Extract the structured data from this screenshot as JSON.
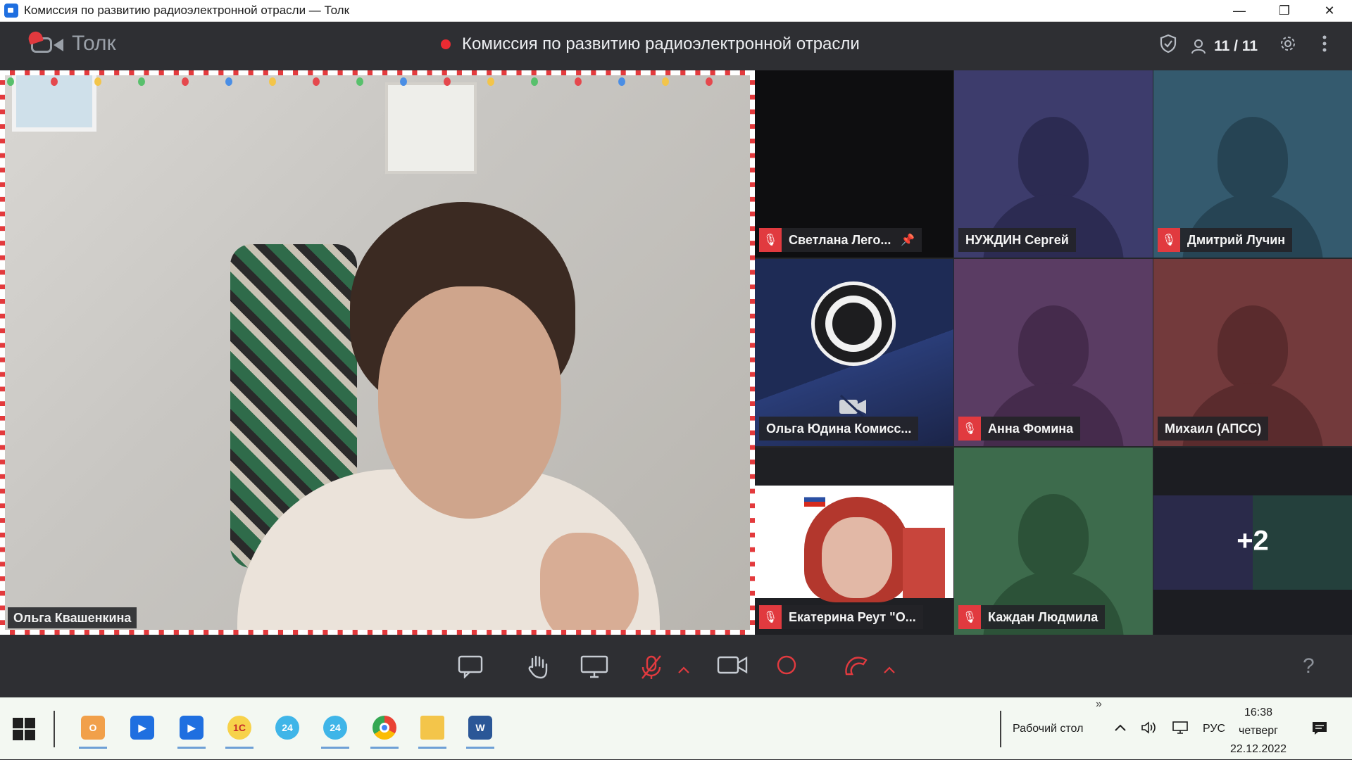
{
  "window": {
    "title": "Комиссия по развитию радиоэлектронной отрасли — Толк",
    "controls": [
      "—",
      "❐",
      "✕"
    ]
  },
  "app": {
    "name": "Толк",
    "meeting_title": "Комиссия по развитию радиоэлектронной отрасли",
    "participants_count": "11 / 11",
    "accent_color": "#e13a3f"
  },
  "main_speaker": {
    "name": "Ольга Квашенкина"
  },
  "tiles": [
    {
      "name": "Светлана Лего...",
      "muted": true,
      "pinned": true,
      "bg": "#0e0e10"
    },
    {
      "name": "НУЖДИН Сергей",
      "muted": false,
      "bg": "#3d3c6c"
    },
    {
      "name": "Дмитрий Лучин",
      "muted": true,
      "bg": "#345a6e"
    },
    {
      "name": "Ольга Юдина Комисс...",
      "muted": false,
      "bg": "#1e2b55"
    },
    {
      "name": "Анна Фомина",
      "muted": true,
      "bg": "#5a3c63"
    },
    {
      "name": "Михаил (АПСС)",
      "muted": false,
      "bg": "#733a3c"
    },
    {
      "name": "Екатерина Реут \"О...",
      "muted": true,
      "bg": "#ffffff"
    },
    {
      "name": "Каждан Людмила",
      "muted": true,
      "bg": "#3d6b4c"
    },
    {
      "name": "+2",
      "bg": "#1c1d22"
    }
  ],
  "toolbar": {
    "help": "?"
  },
  "taskbar": {
    "desktop_label": "Рабочий стол",
    "expand": "»",
    "language": "РУС",
    "time": "16:38",
    "weekday": "четверг",
    "date": "22.12.2022"
  }
}
